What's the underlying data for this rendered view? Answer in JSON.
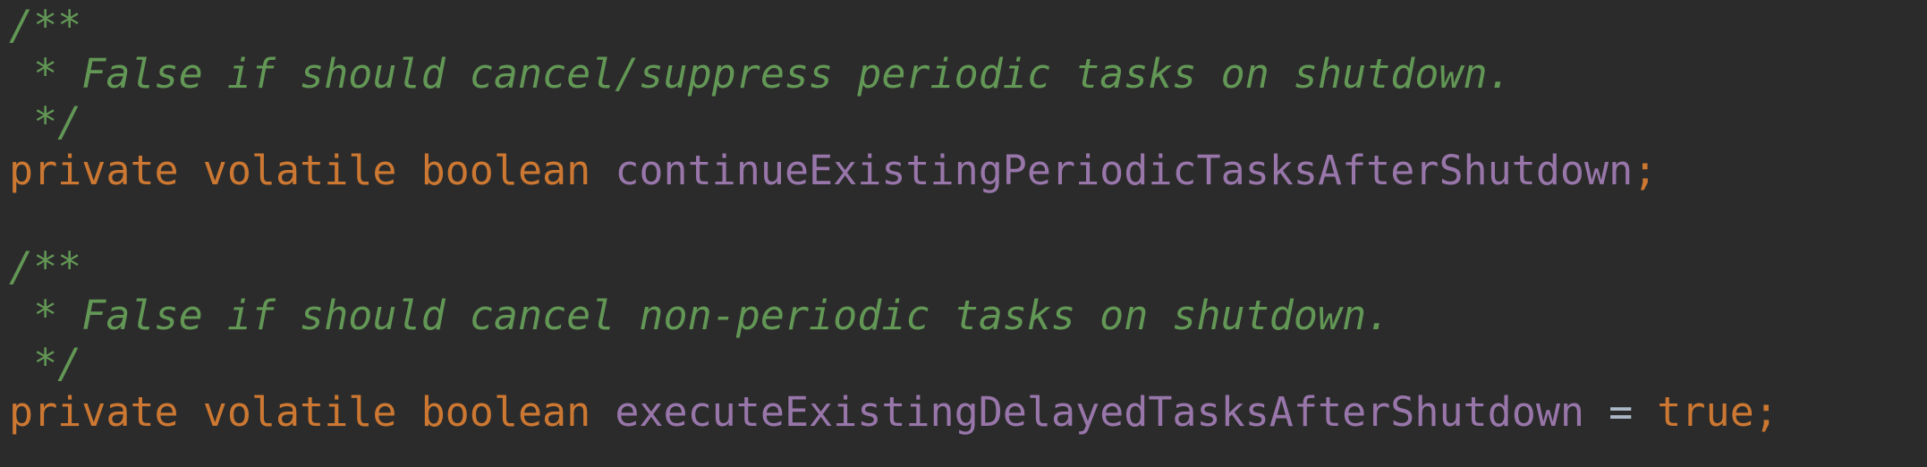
{
  "code": {
    "block1": {
      "comment_open": "/**",
      "comment_body": " * False if should cancel/suppress periodic tasks on shutdown.",
      "comment_close": " */",
      "modifiers": "private volatile boolean ",
      "field_name": "continueExistingPeriodicTasksAfterShutdown",
      "terminator": ";"
    },
    "block2": {
      "comment_open": "/**",
      "comment_body": " * False if should cancel non-periodic tasks on shutdown.",
      "comment_close": " */",
      "modifiers": "private volatile boolean ",
      "field_name": "executeExistingDelayedTasksAfterShutdown",
      "assign_op": " = ",
      "value": "true",
      "terminator": ";"
    }
  },
  "colors": {
    "background": "#2b2b2b",
    "comment": "#629755",
    "keyword": "#cc7832",
    "field": "#9876aa",
    "operator": "#a9b7c6"
  }
}
